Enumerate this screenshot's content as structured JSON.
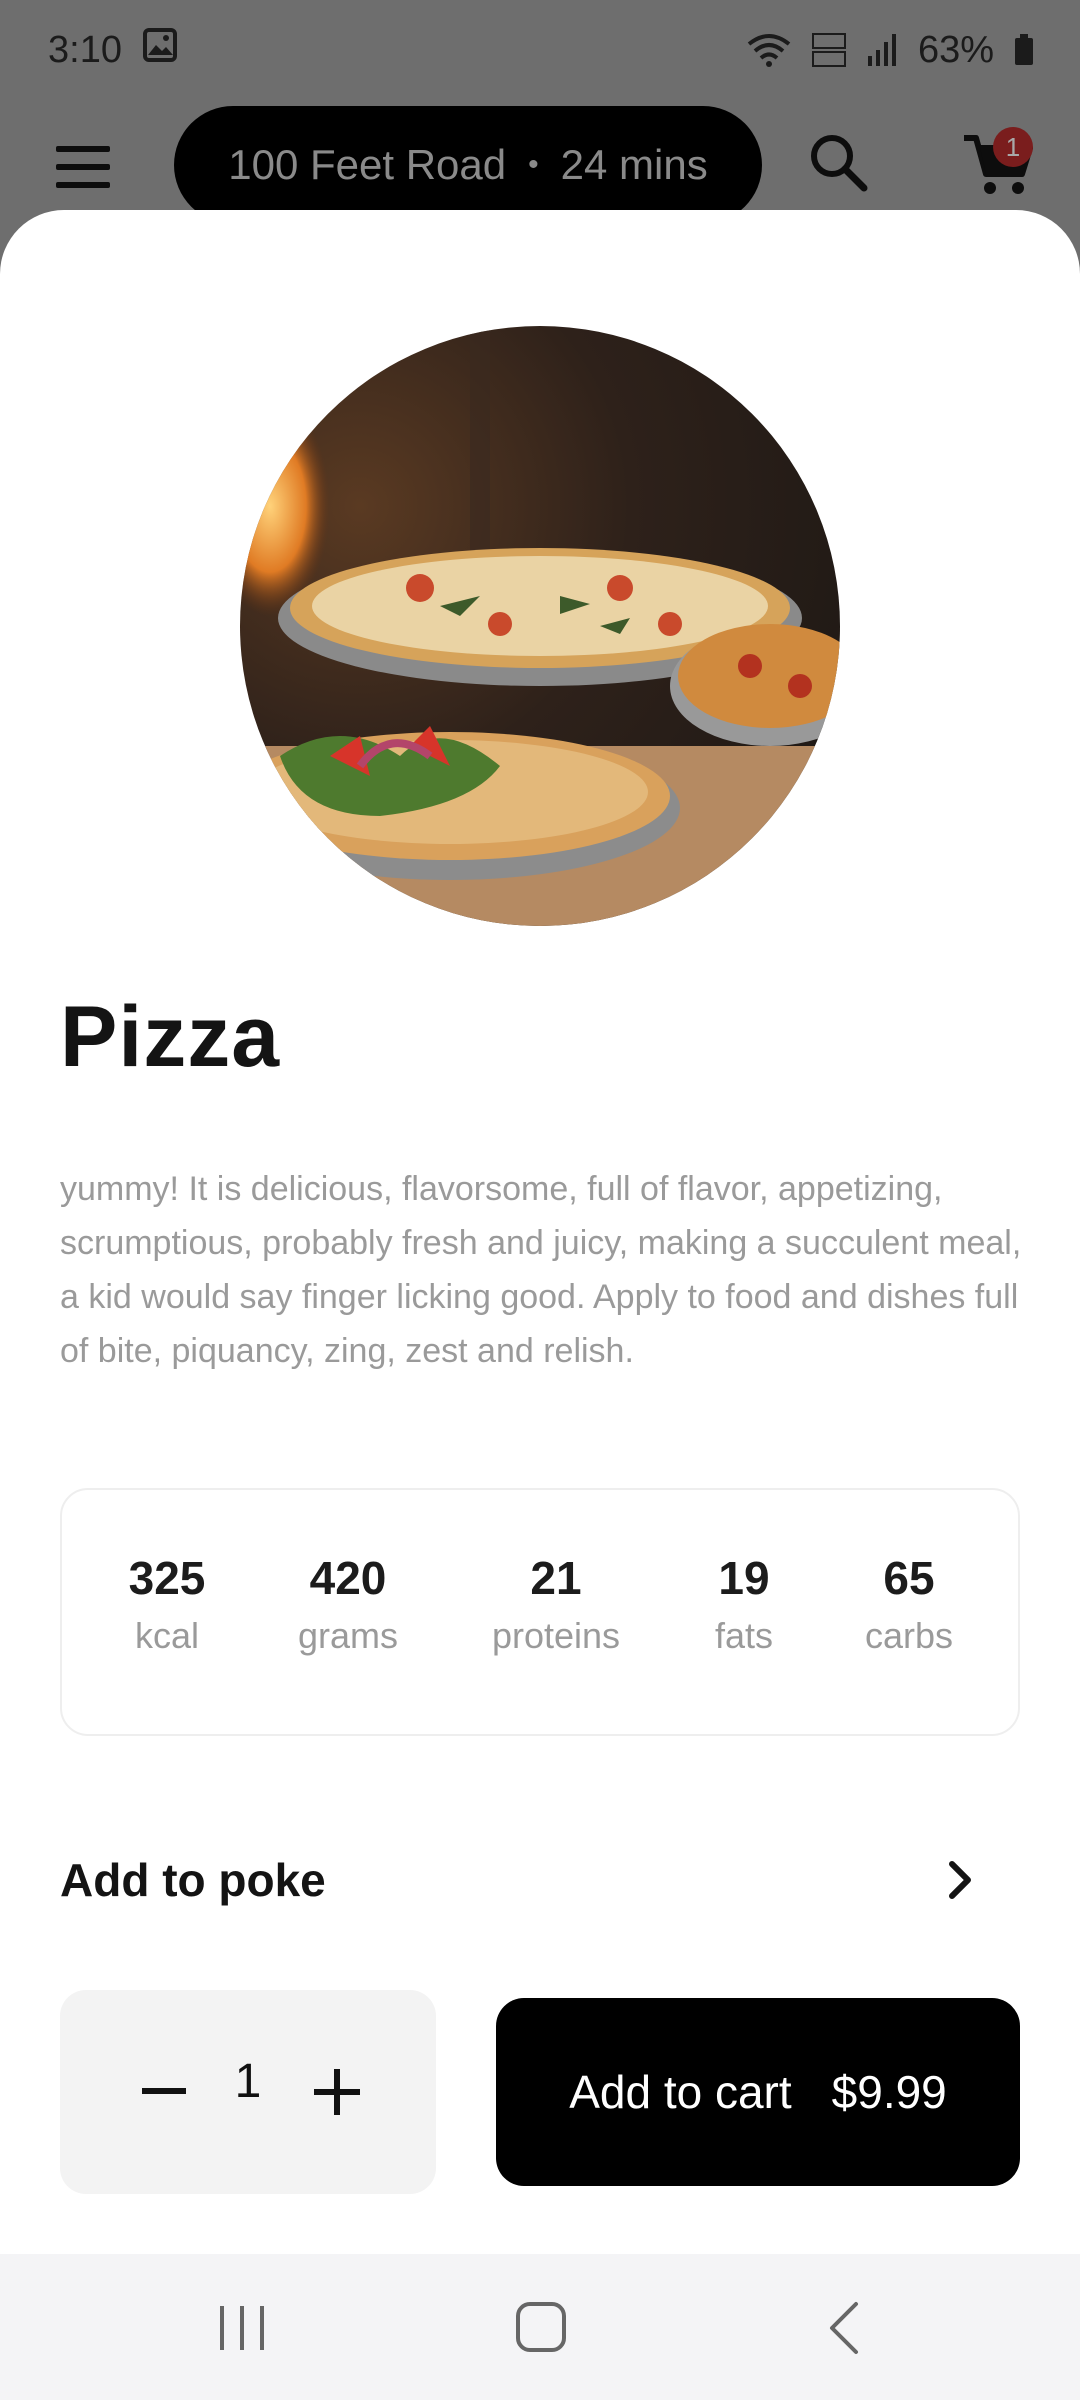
{
  "status_bar": {
    "time": "3:10",
    "battery": "63%"
  },
  "app_bar": {
    "location": "100 Feet Road",
    "separator": "•",
    "eta": "24 mins",
    "cart_count": "1"
  },
  "product": {
    "name": "Pizza",
    "description": "yummy! It is delicious, flavorsome, full of flavor, appetizing, scrumptious, probably fresh and juicy, making a succulent meal, a kid would say finger licking good. Apply to food and dishes full of bite, piquancy, zing, zest and relish.",
    "nutrition": [
      {
        "value": "325",
        "label": "kcal"
      },
      {
        "value": "420",
        "label": "grams"
      },
      {
        "value": "21",
        "label": "proteins"
      },
      {
        "value": "19",
        "label": "fats"
      },
      {
        "value": "65",
        "label": "carbs"
      }
    ]
  },
  "addon": {
    "label": "Add to poke"
  },
  "order": {
    "quantity": "1",
    "add_label": "Add to cart",
    "price": "$9.99"
  },
  "icons": {
    "menu": "hamburger-menu-icon",
    "search": "search-icon",
    "cart": "cart-icon",
    "chevron": "chevron-right-icon",
    "minus": "minus-icon",
    "plus": "plus-icon",
    "nav_recents": "recents-icon",
    "nav_home": "home-icon",
    "nav_back": "back-icon"
  },
  "colors": {
    "scrim": "#6e6e6e",
    "primary": "#000000",
    "muted_text": "#9a9a9a",
    "badge": "#c62828"
  }
}
